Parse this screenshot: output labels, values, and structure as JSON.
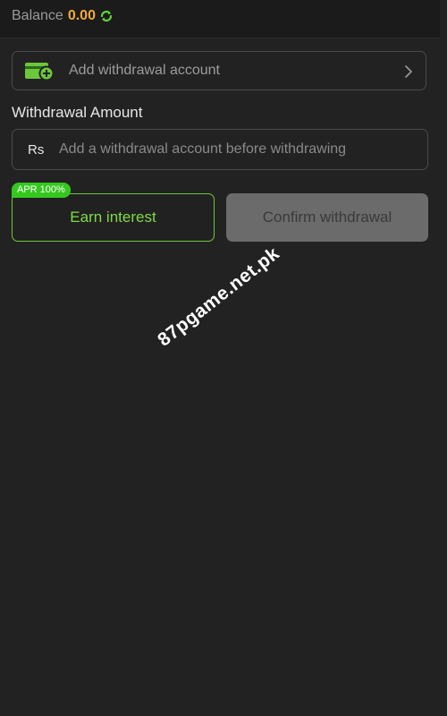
{
  "header": {
    "balance_label": "Balance",
    "balance_value": "0.00",
    "refresh_icon": "refresh-icon"
  },
  "account": {
    "icon": "wallet-add-icon",
    "label": "Add withdrawal account",
    "chevron_icon": "chevron-right-icon"
  },
  "amount": {
    "title": "Withdrawal Amount",
    "currency": "Rs",
    "value": "",
    "placeholder": "Add a withdrawal account before withdrawing"
  },
  "actions": {
    "apr_badge": "APR 100%",
    "earn_label": "Earn interest",
    "confirm_label": "Confirm withdrawal"
  },
  "watermark": "87pgame.net.pk",
  "colors": {
    "background": "#222222",
    "accent_green": "#7edb43",
    "badge_green": "#35c81f",
    "balance_orange": "#f2a93b",
    "disabled_button": "#6b6b6b"
  }
}
